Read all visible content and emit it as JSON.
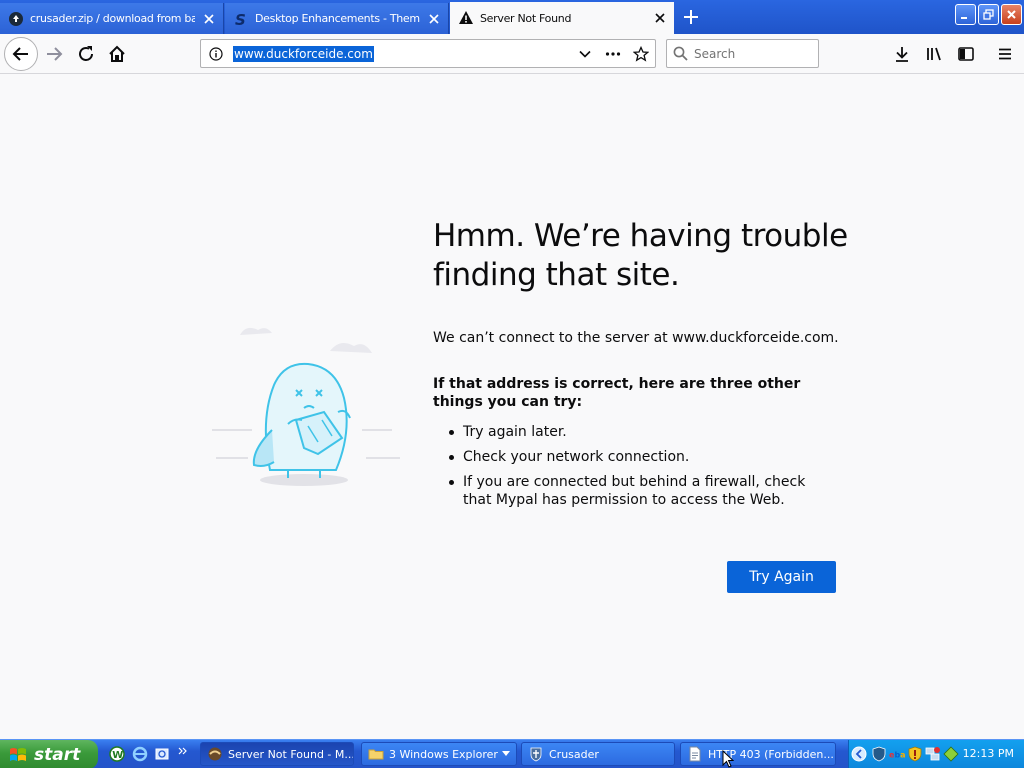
{
  "tabs": [
    {
      "title": "crusader.zip / download from bas",
      "state": "inactive",
      "icon": "cloud-upload-icon"
    },
    {
      "title": "Desktop Enhancements - Themes",
      "state": "inactive",
      "icon": "s-logo-icon"
    },
    {
      "title": "Server Not Found",
      "state": "active",
      "icon": "warning-icon"
    }
  ],
  "toolbar": {
    "url": "www.duckforceide.com",
    "search_placeholder": "Search"
  },
  "error": {
    "title": "Hmm. We’re having trouble finding that site.",
    "description": "We can’t connect to the server at www.duckforceide.com.",
    "advice": "If that address is correct, here are three other things you can try:",
    "suggestions": [
      "Try again later.",
      "Check your network connection.",
      "If you are connected but behind a firewall, check that Mypal has permission to access the Web."
    ],
    "button": "Try Again"
  },
  "taskbar": {
    "start_label": "start",
    "tasks": [
      {
        "label": "Server Not Found - M...",
        "active": true,
        "icon": "mypal-icon"
      },
      {
        "label": "3 Windows Explorer",
        "active": false,
        "icon": "folder-icon"
      },
      {
        "label": "Crusader",
        "active": false,
        "icon": "crusader-icon"
      },
      {
        "label": "HTTP 403 (Forbidden...",
        "active": false,
        "icon": "document-icon"
      }
    ],
    "clock": "12:13 PM"
  },
  "colors": {
    "accent": "#0a64d8",
    "taskbar": "#2458d0",
    "start": "#3a9a3a"
  }
}
